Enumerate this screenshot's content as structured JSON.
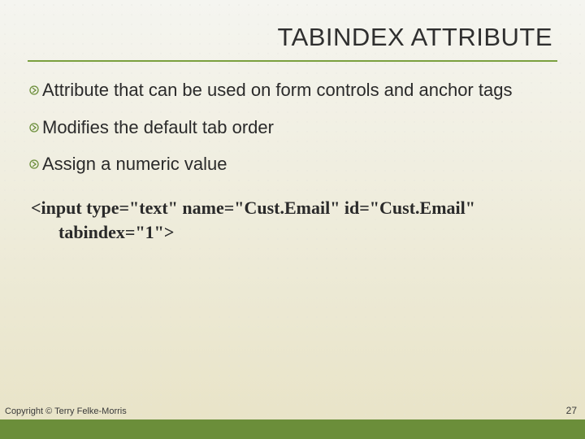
{
  "title": "TABINDEX ATTRIBUTE",
  "bullets": [
    "Attribute that can be used on form controls and anchor tags",
    "Modifies the default tab order",
    "Assign a numeric value"
  ],
  "code": {
    "line1": "<input  type=\"text\" name=\"Cust.Email\" id=\"Cust.Email\"",
    "line2": "tabindex=\"1\">"
  },
  "copyright": "Copyright © Terry Felke-Morris",
  "page_number": "27",
  "colors": {
    "accent": "#6b8e3a"
  }
}
